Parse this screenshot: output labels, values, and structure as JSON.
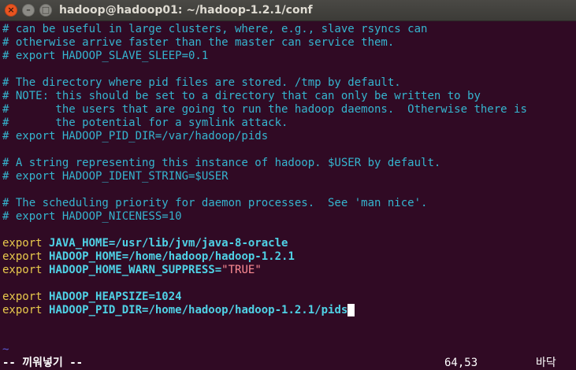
{
  "window": {
    "title": "hadoop@hadoop01: ~/hadoop-1.2.1/conf",
    "buttons": {
      "close": "×",
      "minimize": "–",
      "maximize": "□"
    }
  },
  "editor": {
    "lines": [
      {
        "type": "comment",
        "text": "# can be useful in large clusters, where, e.g., slave rsyncs can"
      },
      {
        "type": "comment",
        "text": "# otherwise arrive faster than the master can service them."
      },
      {
        "type": "comment",
        "text": "# export HADOOP_SLAVE_SLEEP=0.1"
      },
      {
        "type": "blank",
        "text": ""
      },
      {
        "type": "comment",
        "text": "# The directory where pid files are stored. /tmp by default."
      },
      {
        "type": "comment",
        "text": "# NOTE: this should be set to a directory that can only be written to by"
      },
      {
        "type": "comment",
        "text": "#       the users that are going to run the hadoop daemons.  Otherwise there is"
      },
      {
        "type": "comment",
        "text": "#       the potential for a symlink attack."
      },
      {
        "type": "comment",
        "text": "# export HADOOP_PID_DIR=/var/hadoop/pids"
      },
      {
        "type": "blank",
        "text": ""
      },
      {
        "type": "comment",
        "text": "# A string representing this instance of hadoop. $USER by default."
      },
      {
        "type": "comment",
        "text": "# export HADOOP_IDENT_STRING=$USER"
      },
      {
        "type": "blank",
        "text": ""
      },
      {
        "type": "comment",
        "text": "# The scheduling priority for daemon processes.  See 'man nice'."
      },
      {
        "type": "comment",
        "text": "# export HADOOP_NICENESS=10"
      },
      {
        "type": "blank",
        "text": ""
      },
      {
        "type": "export",
        "keyword": "export",
        "assign": "JAVA_HOME=/usr/lib/jvm/java-8-oracle",
        "string": ""
      },
      {
        "type": "export",
        "keyword": "export",
        "assign": "HADOOP_HOME=/home/hadoop/hadoop-1.2.1",
        "string": ""
      },
      {
        "type": "export",
        "keyword": "export",
        "assign": "HADOOP_HOME_WARN_SUPPRESS=",
        "string": "\"TRUE\""
      },
      {
        "type": "blank",
        "text": ""
      },
      {
        "type": "export",
        "keyword": "export",
        "assign": "HADOOP_HEAPSIZE=1024",
        "string": ""
      },
      {
        "type": "export",
        "keyword": "export",
        "assign": "HADOOP_PID_DIR=/home/hadoop/hadoop-1.2.1/pids",
        "string": "",
        "cursor": true
      }
    ],
    "empty_line_marker": "~"
  },
  "status": {
    "mode": "-- 끼워넣기 --",
    "position": "64,53",
    "scroll": "바닥"
  },
  "colors": {
    "background": "#300a24",
    "comment": "#35b5cf",
    "keyword": "#e8c94c",
    "variable": "#4fd2e6",
    "string": "#ff8d95",
    "tilde": "#5b5bd6"
  }
}
